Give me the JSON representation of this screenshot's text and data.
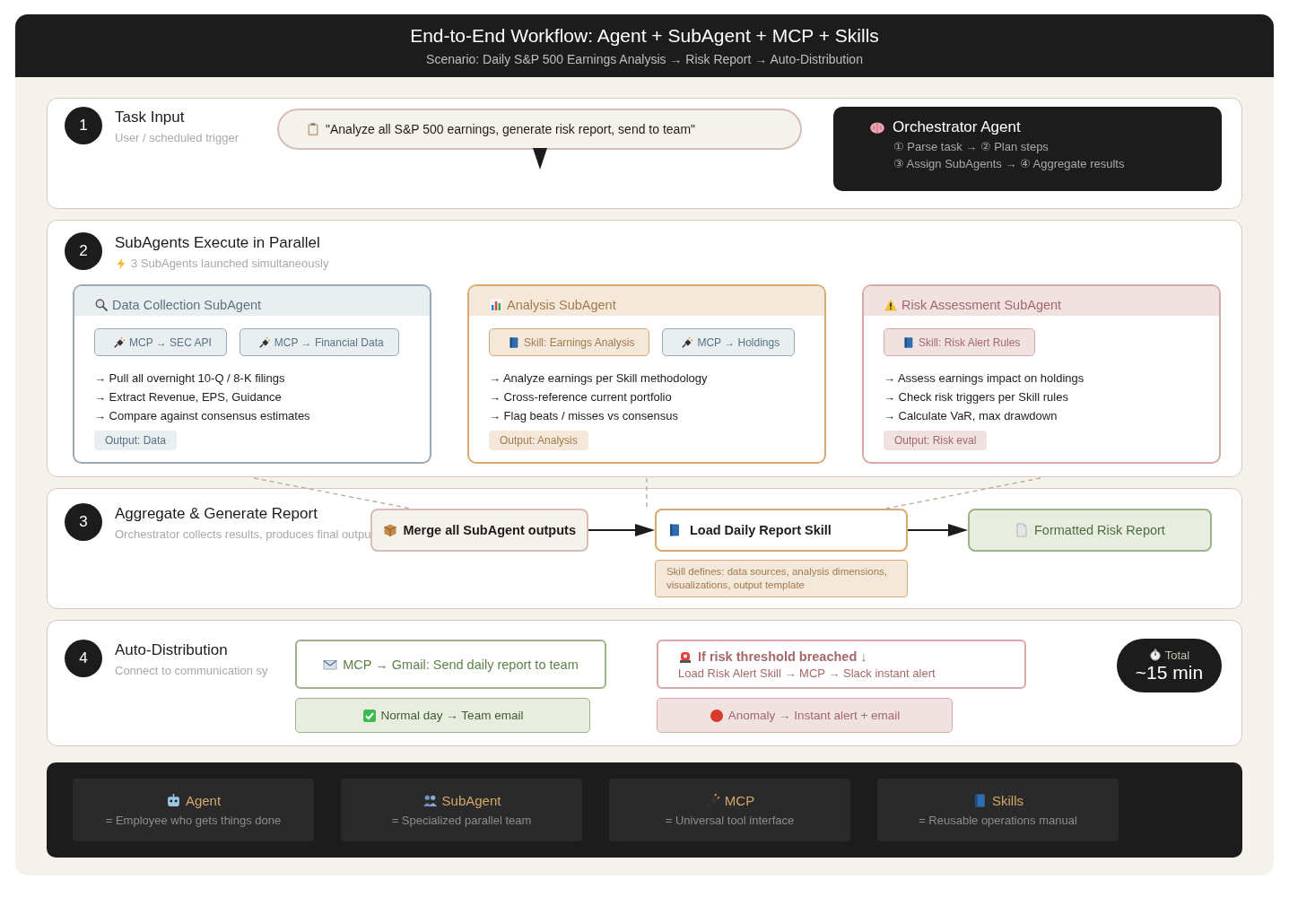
{
  "header": {
    "title": "End-to-End Workflow: Agent + SubAgent + MCP + Skills",
    "subtitle": "Scenario: Daily S&P 500 Earnings Analysis → Risk Report → Auto-Distribution"
  },
  "step1": {
    "number": "1",
    "title": "Task Input",
    "subtitle": "User / scheduled trigger",
    "prompt": "\"Analyze all S&P 500 earnings, generate risk report, send to team\"",
    "orchestrator": {
      "title": "Orchestrator Agent",
      "steps": [
        "① Parse task → ② Plan steps",
        "③ Assign SubAgents → ④ Aggregate results"
      ]
    }
  },
  "step2": {
    "number": "2",
    "title": "SubAgents Execute in Parallel",
    "subtitle": "3 SubAgents launched simultaneously",
    "subagents": [
      {
        "kind": "data",
        "title": "Data Collection SubAgent",
        "chips": [
          {
            "kind": "mcp",
            "label": "MCP → SEC API"
          },
          {
            "kind": "mcp",
            "label": "MCP → Financial Data"
          }
        ],
        "tasks": [
          "→ Pull all overnight 10-Q / 8-K filings",
          "→ Extract Revenue, EPS, Guidance",
          "→ Compare against consensus estimates"
        ],
        "output": "Output: Data"
      },
      {
        "kind": "analysis",
        "title": "Analysis SubAgent",
        "chips": [
          {
            "kind": "skill",
            "label": "Skill: Earnings Analysis"
          },
          {
            "kind": "mcp",
            "label": "MCP → Holdings"
          }
        ],
        "tasks": [
          "→ Analyze earnings per Skill methodology",
          "→ Cross-reference current portfolio",
          "→ Flag beats / misses vs consensus"
        ],
        "output": "Output: Analysis"
      },
      {
        "kind": "risk",
        "title": "Risk Assessment SubAgent",
        "chips": [
          {
            "kind": "skill",
            "label": "Skill: Risk Alert Rules"
          }
        ],
        "tasks": [
          "→ Assess earnings impact on holdings",
          "→ Check risk triggers per Skill rules",
          "→ Calculate VaR, max drawdown"
        ],
        "output": "Output: Risk eval"
      }
    ]
  },
  "step3": {
    "number": "3",
    "title": "Aggregate & Generate Report",
    "subtitle": "Orchestrator collects results, produces final outpu",
    "merge": "Merge all SubAgent outputs",
    "skill": "Load Daily Report Skill",
    "skill_note": "Skill defines: data sources, analysis dimensions, visualizations, output template",
    "result": "Formatted Risk Report"
  },
  "step4": {
    "number": "4",
    "title": "Auto-Distribution",
    "subtitle": "Connect to communication sy",
    "channels": [
      {
        "kind": "normal",
        "title": "MCP → Gmail: Send daily report to team",
        "outcome": "Normal day → Team email"
      },
      {
        "kind": "alert",
        "title": "If risk threshold breached ↓",
        "detail": "Load Risk Alert Skill → MCP → Slack instant alert",
        "outcome": "Anomaly → Instant alert + email"
      }
    ],
    "timer": {
      "label": "Total",
      "value": "~15 min"
    }
  },
  "legend": [
    {
      "kind": "agent",
      "title": "Agent",
      "desc": "= Employee who gets things done"
    },
    {
      "kind": "subagent",
      "title": "SubAgent",
      "desc": "= Specialized parallel team"
    },
    {
      "kind": "mcp",
      "title": "MCP",
      "desc": "= Universal tool interface"
    },
    {
      "kind": "skills",
      "title": "Skills",
      "desc": "= Reusable operations manual"
    }
  ]
}
